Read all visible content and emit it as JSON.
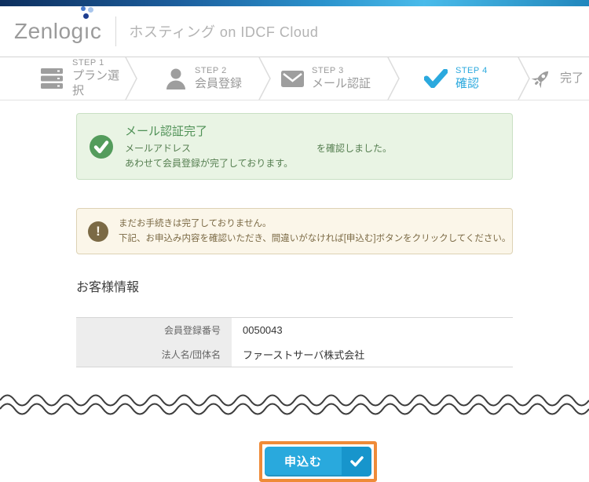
{
  "header": {
    "logo": "Zenlogic",
    "logo_part1": "Zenlog",
    "logo_i": "ı",
    "logo_part2": "c",
    "subtitle": "ホスティング on IDCF Cloud"
  },
  "steps": [
    {
      "step": "STEP 1",
      "label": "プラン選択",
      "icon": "servers-icon",
      "active": false
    },
    {
      "step": "STEP 2",
      "label": "会員登録",
      "icon": "person-icon",
      "active": false
    },
    {
      "step": "STEP 3",
      "label": "メール認証",
      "icon": "envelope-icon",
      "active": false
    },
    {
      "step": "STEP 4",
      "label": "確認",
      "icon": "check-icon",
      "active": true
    },
    {
      "step": "",
      "label": "完了",
      "icon": "rocket-icon",
      "active": false
    }
  ],
  "success_box": {
    "title": "メール認証完了",
    "line1_prefix": "メールアドレス",
    "line1_suffix": "を確認しました。",
    "line2": "あわせて会員登録が完了しております。"
  },
  "warning_box": {
    "icon_glyph": "!",
    "line1": "まだお手続きは完了しておりません。",
    "line2": "下記、お申込み内容を確認いただき、間違いがなければ[申込む]ボタンをクリックしてください。"
  },
  "customer_info": {
    "heading": "お客様情報",
    "rows": [
      {
        "label": "会員登録番号",
        "value": "0050043"
      },
      {
        "label": "法人名/団体名",
        "value": "ファーストサーバ株式会社"
      }
    ]
  },
  "submit": {
    "label": "申込む"
  },
  "colors": {
    "accent_blue": "#2ba9de",
    "button_blue": "#29a9dd",
    "button_blue_dark": "#1795cc",
    "success_green": "#549c5c",
    "success_bg": "#e9f4e4",
    "warning_brown": "#7b6a45",
    "warning_bg": "#fbf6e9",
    "annotation_orange": "#ef8b38",
    "step_gray": "#9a9a9a"
  }
}
